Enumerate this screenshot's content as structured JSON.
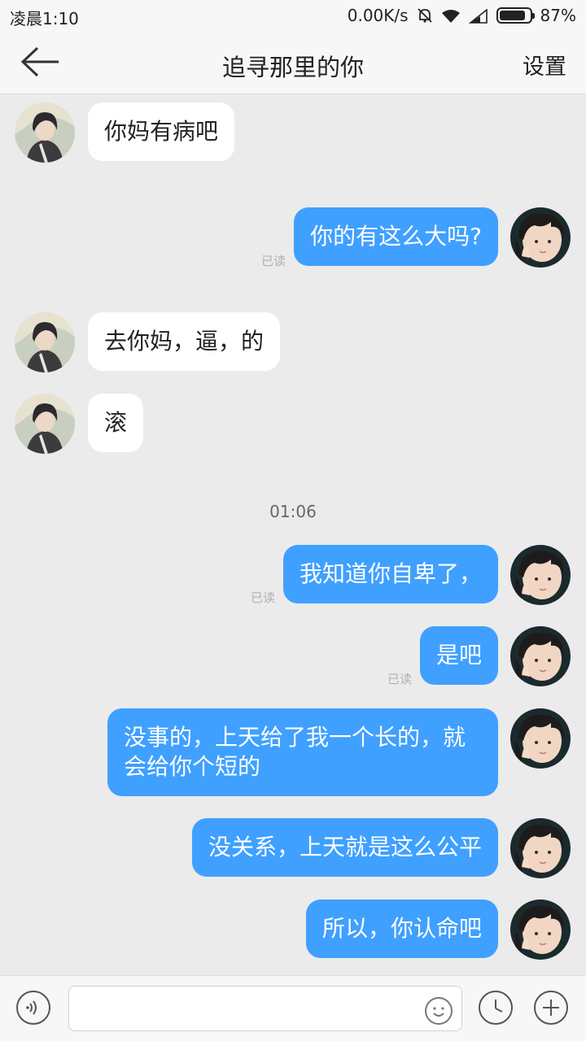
{
  "status_bar": {
    "time": "凌晨1:10",
    "net_speed": "0.00K/s",
    "battery": "87%",
    "battery_level": 0.87,
    "icons": [
      "bell-off-icon",
      "wifi-icon",
      "signal-icon",
      "battery-icon"
    ]
  },
  "header": {
    "back_icon": "back-arrow-icon",
    "title": "追寻那里的你",
    "settings_label": "设置"
  },
  "messages": [
    {
      "side": "in",
      "text": "你妈有病吧"
    },
    {
      "side": "out",
      "text": "你的有这么大吗?",
      "read": "已读"
    },
    {
      "side": "in",
      "text": "去你妈，逼，的"
    },
    {
      "side": "in",
      "text": "滚"
    },
    {
      "type": "timestamp",
      "text": "01:06"
    },
    {
      "side": "out",
      "text": "我知道你自卑了，",
      "read": "已读"
    },
    {
      "side": "out",
      "text": "是吧",
      "read": "已读"
    },
    {
      "side": "out",
      "text": "没事的，上天给了我一个长的，就会给你个短的"
    },
    {
      "side": "out",
      "text": "没关系，上天就是这么公平"
    },
    {
      "side": "out",
      "text": "所以，你认命吧"
    }
  ],
  "input_bar": {
    "voice_icon": "voice-icon",
    "placeholder": "",
    "emoji_icon": "emoji-icon",
    "clock_icon": "clock-icon",
    "plus_icon": "plus-icon"
  },
  "colors": {
    "background": "#ebebeb",
    "out_bubble": "#3fa0ff",
    "in_bubble": "#ffffff",
    "bar": "#f7f7f7"
  }
}
